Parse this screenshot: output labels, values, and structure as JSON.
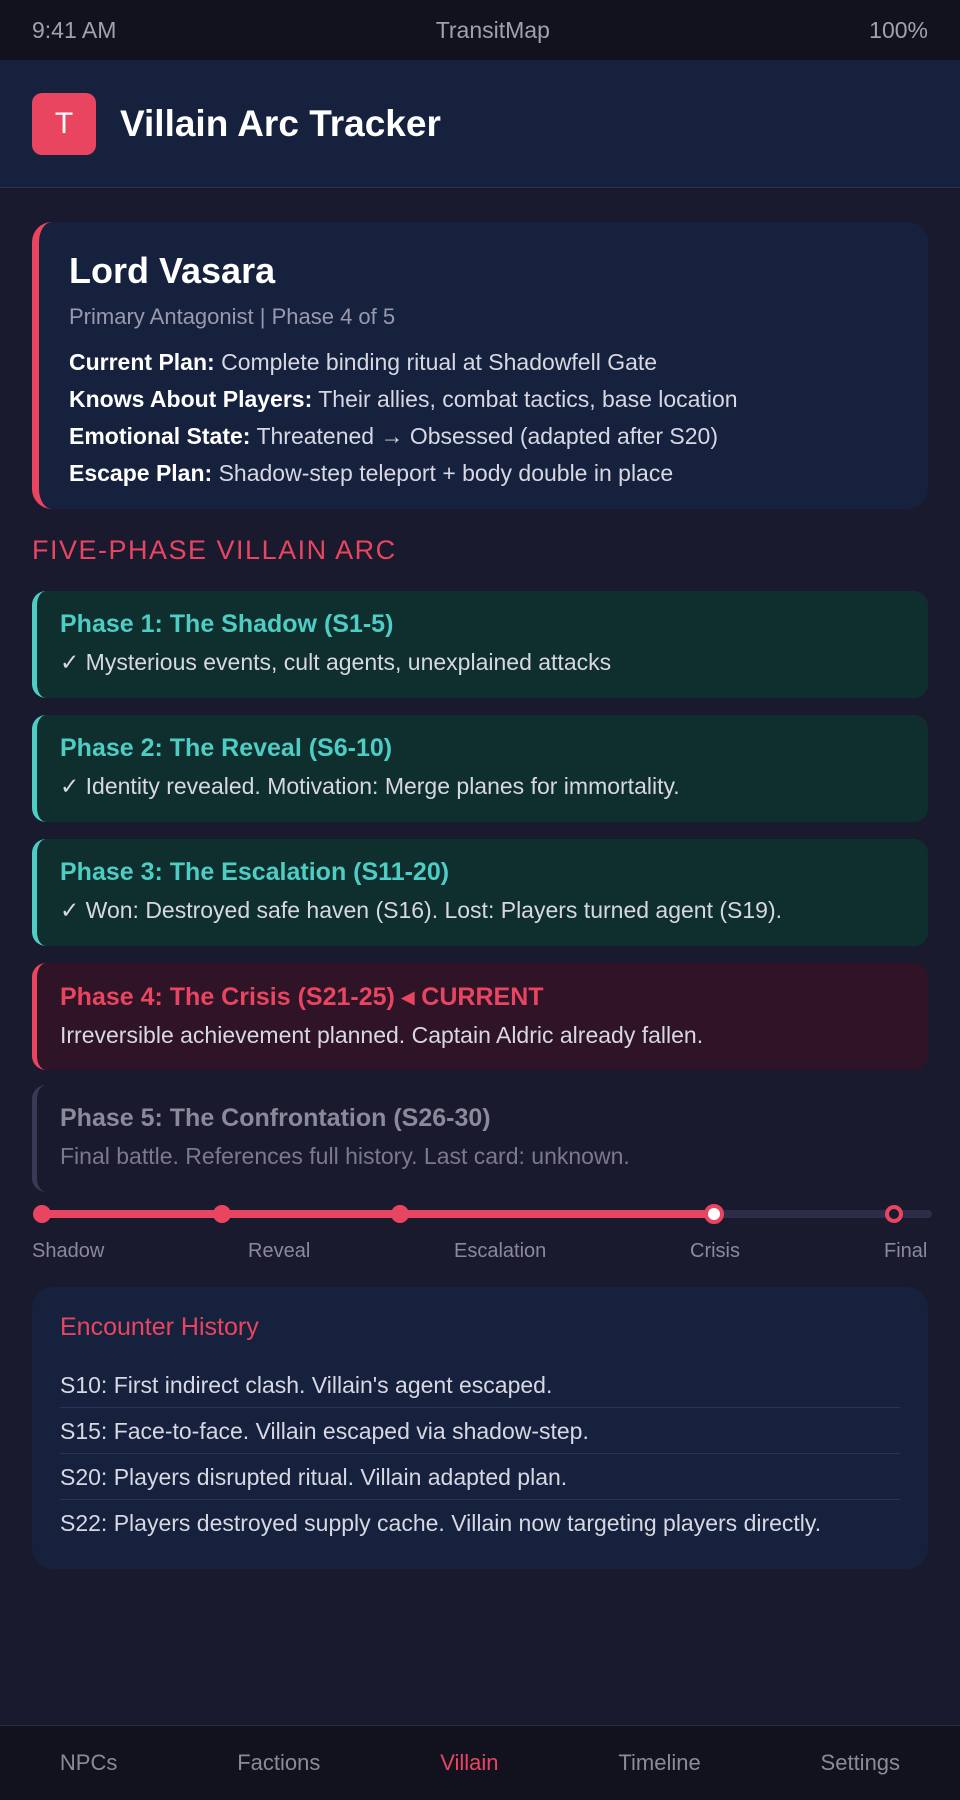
{
  "status_bar": {
    "time": "9:41 AM",
    "app_name": "TransitMap",
    "battery": "100%"
  },
  "header": {
    "logo_letter": "T",
    "title": "Villain Arc Tracker"
  },
  "villain": {
    "name": "Lord Vasara",
    "subtitle": "Primary Antagonist | Phase 4 of 5",
    "fields": [
      {
        "label": "Current Plan:",
        "value": "Complete binding ritual at Shadowfell Gate"
      },
      {
        "label": "Knows About Players:",
        "value": "Their allies, combat tactics, base location"
      },
      {
        "label": "Emotional State:",
        "value": "Threatened → Obsessed (adapted after S20)"
      },
      {
        "label": "Escape Plan:",
        "value": "Shadow-step teleport + body double in place"
      }
    ]
  },
  "arc_section_title": "FIVE-PHASE VILLAIN ARC",
  "phases": [
    {
      "title": "Phase 1: The Shadow (S1-5)",
      "desc": "✓ Mysterious events, cult agents, unexplained attacks",
      "status": "done"
    },
    {
      "title": "Phase 2: The Reveal (S6-10)",
      "desc": "✓ Identity revealed. Motivation: Merge planes for immortality.",
      "status": "done"
    },
    {
      "title": "Phase 3: The Escalation (S11-20)",
      "desc": "✓ Won: Destroyed safe haven (S16). Lost: Players turned agent (S19).",
      "status": "done"
    },
    {
      "title": "Phase 4: The Crisis (S21-25) ◂ CURRENT",
      "desc": "Irreversible achievement planned. Captain Aldric already fallen.",
      "status": "current"
    },
    {
      "title": "Phase 5: The Confrontation (S26-30)",
      "desc": "Final battle. References full history. Last card: unknown.",
      "status": "future"
    }
  ],
  "progress": {
    "labels": [
      "Shadow",
      "Reveal",
      "Escalation",
      "Crisis",
      "Final"
    ],
    "current_index": 3,
    "accent_color": "#e94560",
    "track_color": "#2d2d4a"
  },
  "history": {
    "title": "Encounter History",
    "items": [
      "S10: First indirect clash. Villain's agent escaped.",
      "S15: Face-to-face. Villain escaped via shadow-step.",
      "S20: Players disrupted ritual. Villain adapted plan.",
      "S22: Players destroyed supply cache. Villain now targeting players directly."
    ]
  },
  "nav": {
    "items": [
      "NPCs",
      "Factions",
      "Villain",
      "Timeline",
      "Settings"
    ],
    "active_index": 2
  },
  "colors": {
    "accent": "#e94560",
    "done": "#4ecdc4",
    "background": "#1a1a2e",
    "card": "#16213e"
  }
}
